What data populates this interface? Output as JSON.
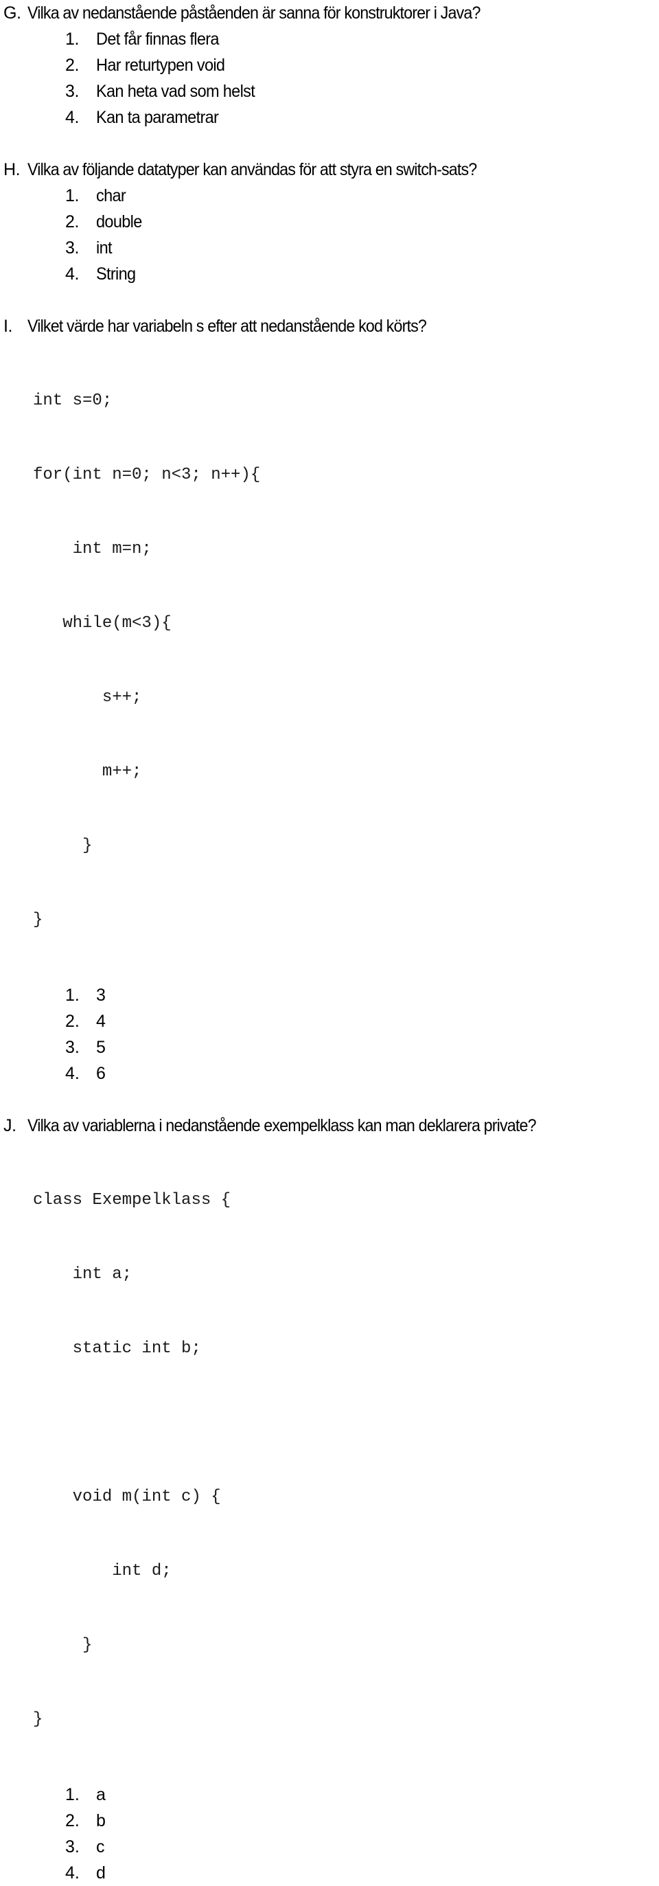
{
  "document": {
    "language": "sv",
    "background_color": "#ffffff",
    "text_color": "#000000"
  },
  "questions": [
    {
      "letter": "G.",
      "prompt": "Vilka av nedanstående påståenden är sanna för konstruktorer i Java?",
      "options": [
        {
          "num": "1.",
          "label": "Det får finnas flera"
        },
        {
          "num": "2.",
          "label": "Har returtypen void"
        },
        {
          "num": "3.",
          "label": "Kan heta vad som helst"
        },
        {
          "num": "4.",
          "label": "Kan ta parametrar"
        }
      ]
    },
    {
      "letter": "H.",
      "prompt": "Vilka av följande datatyper kan användas för att styra en switch-sats?",
      "options": [
        {
          "num": "1.",
          "label": "char"
        },
        {
          "num": "2.",
          "label": "double"
        },
        {
          "num": "3.",
          "label": "int"
        },
        {
          "num": "4.",
          "label": "String"
        }
      ]
    },
    {
      "letter": "I.",
      "prompt": "Vilket värde har variabeln s efter att nedanstående kod körts?",
      "code_lines": [
        "int s=0;",
        "for(int n=0; n<3; n++){",
        "    int m=n;",
        "   while(m<3){",
        "       s++;",
        "       m++;",
        "     }",
        "}"
      ],
      "options": [
        {
          "num": "1.",
          "label": "3"
        },
        {
          "num": "2.",
          "label": "4"
        },
        {
          "num": "3.",
          "label": "5"
        },
        {
          "num": "4.",
          "label": "6"
        }
      ]
    },
    {
      "letter": "J.",
      "prompt": "Vilka av variablerna i nedanstående exempelklass kan man deklarera private?",
      "code_lines": [
        "class Exempelklass {",
        "    int a;",
        "    static int b;",
        "",
        "    void m(int c) {",
        "        int d;",
        "     }",
        "}"
      ],
      "options": [
        {
          "num": "1.",
          "label": "a"
        },
        {
          "num": "2.",
          "label": "b"
        },
        {
          "num": "3.",
          "label": "c"
        },
        {
          "num": "4.",
          "label": "d"
        }
      ]
    }
  ]
}
